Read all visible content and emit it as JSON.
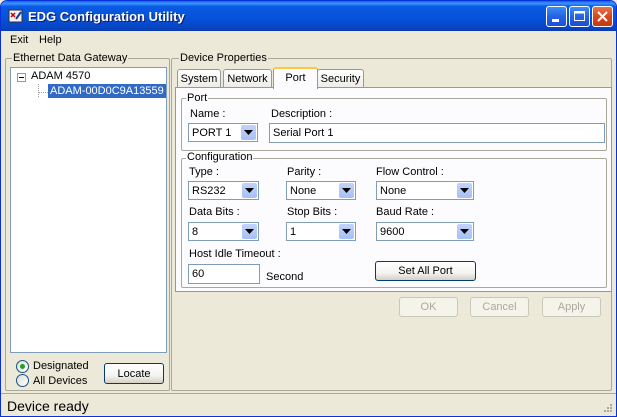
{
  "window": {
    "title": "EDG Configuration Utility"
  },
  "menu": {
    "items": [
      "Exit",
      "Help"
    ]
  },
  "gateway_panel": {
    "title": "Ethernet Data Gateway",
    "tree_root": "ADAM 4570",
    "tree_child": "ADAM-00D0C9A13559",
    "radio_designated": "Designated",
    "radio_all_devices": "All Devices",
    "selected_radio": "Designated",
    "locate_label": "Locate"
  },
  "device_panel": {
    "title": "Device Properties",
    "tabs": [
      "System",
      "Network",
      "Port",
      "Security"
    ],
    "active_tab": "Port"
  },
  "port_group": {
    "title": "Port",
    "name_label": "Name :",
    "name_value": "PORT 1",
    "description_label": "Description :",
    "description_value": "Serial Port 1"
  },
  "config_group": {
    "title": "Configuration",
    "type_label": "Type :",
    "type_value": "RS232",
    "parity_label": "Parity :",
    "parity_value": "None",
    "flow_label": "Flow Control :",
    "flow_value": "None",
    "databits_label": "Data Bits :",
    "databits_value": "8",
    "stopbits_label": "Stop Bits :",
    "stopbits_value": "1",
    "baud_label": "Baud Rate :",
    "baud_value": "9600",
    "idle_label": "Host Idle Timeout :",
    "idle_value": "60",
    "idle_unit": "Second",
    "set_all_label": "Set All Port"
  },
  "dialog_buttons": {
    "ok": "OK",
    "cancel": "Cancel",
    "apply": "Apply"
  },
  "status": {
    "text": "Device ready"
  },
  "colors": {
    "title_bar": "#0A5AE3",
    "selection": "#316AC5",
    "active_tab_accent": "#FFC83C",
    "face": "#ECE9D8"
  }
}
